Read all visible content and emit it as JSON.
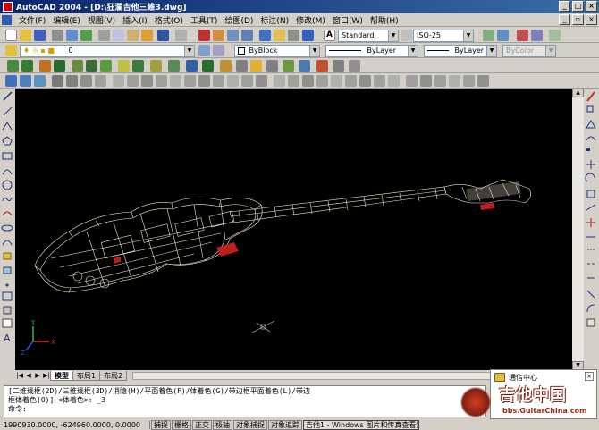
{
  "window": {
    "title": "AutoCAD 2004 - [D:\\狂瀾吉他三維3.dwg]"
  },
  "menu": {
    "items": [
      "文件(F)",
      "编辑(E)",
      "视图(V)",
      "插入(I)",
      "格式(O)",
      "工具(T)",
      "绘图(D)",
      "标注(N)",
      "修改(M)",
      "窗口(W)",
      "帮助(H)"
    ]
  },
  "toolbar": {
    "text_style": "Standard",
    "dim_style": "ISO-25",
    "layer": "0",
    "color": "ByBlock",
    "linetype": "ByLayer",
    "lineweight": "ByLayer",
    "plotstyle": "ByColor"
  },
  "tabs": {
    "items": [
      "模型",
      "布局1",
      "布局2"
    ]
  },
  "command": {
    "line1": "[二维线框(2D)/三维线框(3D)/消隐(H)/平面着色(F)/体着色(G)/带边框平面着色(L)/带边",
    "line2": "框体着色(O)] <体着色>: _3",
    "prompt": "命令:"
  },
  "status": {
    "coords": "1990930.0000, -624960.0000, 0.0000",
    "buttons": [
      "捕捉",
      "栅格",
      "正交",
      "极轴",
      "对象捕捉",
      "对象追踪"
    ],
    "taskbar_item": "吉他1 - Windows 图片和传真查看器"
  },
  "notification": {
    "title": "通信中心"
  },
  "watermark": {
    "text": "吉他中国",
    "url": "bbs.GuitarChina.com"
  },
  "ucs": {
    "x": "X",
    "y": "Y",
    "z": "Z"
  }
}
